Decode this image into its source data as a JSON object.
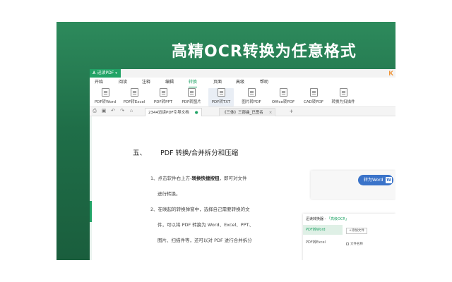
{
  "hero": {
    "title": "高精OCR转换为任意格式"
  },
  "app": {
    "badge_label": "迅读PDF",
    "corner_logo": "K",
    "menu": [
      {
        "label": "开始"
      },
      {
        "label": "阅读"
      },
      {
        "label": "注释"
      },
      {
        "label": "编辑"
      },
      {
        "label": "转换",
        "active": true
      },
      {
        "label": "页面"
      },
      {
        "label": "高级"
      },
      {
        "label": "帮助"
      }
    ],
    "tools": [
      {
        "label": "PDF转Word"
      },
      {
        "label": "PDF转Excel"
      },
      {
        "label": "PDF转PPT"
      },
      {
        "label": "PDF转图片"
      },
      {
        "label": "PDF转TXT",
        "selected": true
      },
      {
        "label": "图片转PDF"
      },
      {
        "label": "Office转PDF"
      },
      {
        "label": "CAD转PDF"
      },
      {
        "label": "转换为扫描件"
      }
    ],
    "tabs": {
      "active": "2344迅读PDF引导文档",
      "other": "《三体》三部曲_已签名",
      "new_tab": "+"
    }
  },
  "document": {
    "section_number": "五、",
    "section_title": "PDF 转换/合并拆分和压缩",
    "lines": [
      {
        "prefix": "1、点击软件右上方-",
        "bold": "转换快捷按钮",
        "suffix": "，即可对文件"
      },
      {
        "text": "进行转换。"
      },
      {
        "text": "2、在唤起的转换弹窗中，选择自己需要转换的文"
      },
      {
        "text": "件，可以将 PDF 转换为 Word、Excel、PPT、"
      },
      {
        "text": "图片、扫描件等，还可以对 PDF 进行合并拆分"
      }
    ]
  },
  "inset_top": {
    "button_label": "转为Word",
    "icon_glyph": "W"
  },
  "inset_bottom": {
    "title_prefix": "迅读转换器 - ",
    "title_highlight": "「高级OCR」",
    "rows": [
      {
        "label": "PDF转Word",
        "selected": true
      },
      {
        "label": "PDF转Excel"
      }
    ],
    "add_file_label": "+添加文件",
    "check_label": "文件名称"
  },
  "colors": {
    "accent": "#21a366",
    "banner": "#1f6e48",
    "word_blue": "#3a73c9"
  }
}
